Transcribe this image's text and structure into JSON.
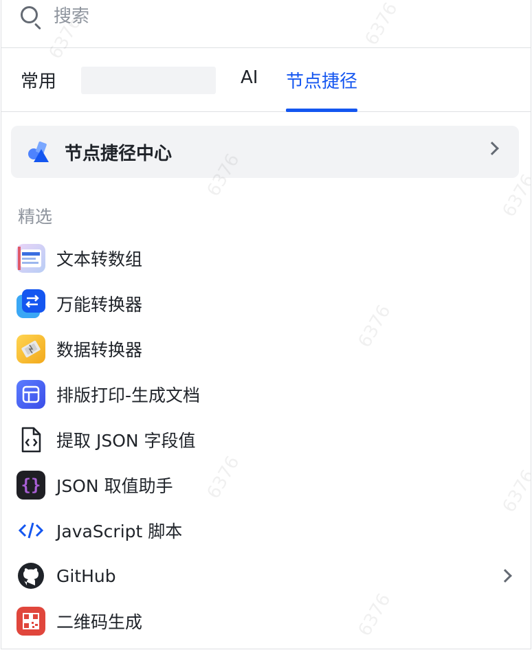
{
  "search": {
    "placeholder": "搜索"
  },
  "tabs": [
    {
      "label": "常用"
    },
    {
      "label": "AI"
    },
    {
      "label": "节点捷径",
      "active": true
    }
  ],
  "center_card": {
    "label": "节点捷径中心"
  },
  "section": {
    "title": "精选"
  },
  "items": [
    {
      "label": "文本转数组",
      "icon": "text-to-array-icon",
      "has_submenu": false
    },
    {
      "label": "万能转换器",
      "icon": "universal-converter-icon",
      "has_submenu": false
    },
    {
      "label": "数据转换器",
      "icon": "data-converter-icon",
      "has_submenu": false
    },
    {
      "label": "排版打印-生成文档",
      "icon": "layout-print-icon",
      "has_submenu": false
    },
    {
      "label": "提取 JSON 字段值",
      "icon": "json-file-icon",
      "has_submenu": false
    },
    {
      "label": "JSON 取值助手",
      "icon": "json-braces-icon",
      "has_submenu": false
    },
    {
      "label": "JavaScript 脚本",
      "icon": "code-icon",
      "has_submenu": false
    },
    {
      "label": "GitHub",
      "icon": "github-icon",
      "has_submenu": true
    },
    {
      "label": "二维码生成",
      "icon": "qr-code-icon",
      "has_submenu": false
    }
  ],
  "watermark": {
    "text": "6376"
  },
  "colors": {
    "accent": "#1456f0",
    "text": "#1f2329",
    "muted": "#8f959e",
    "card_bg": "#f2f3f5"
  }
}
